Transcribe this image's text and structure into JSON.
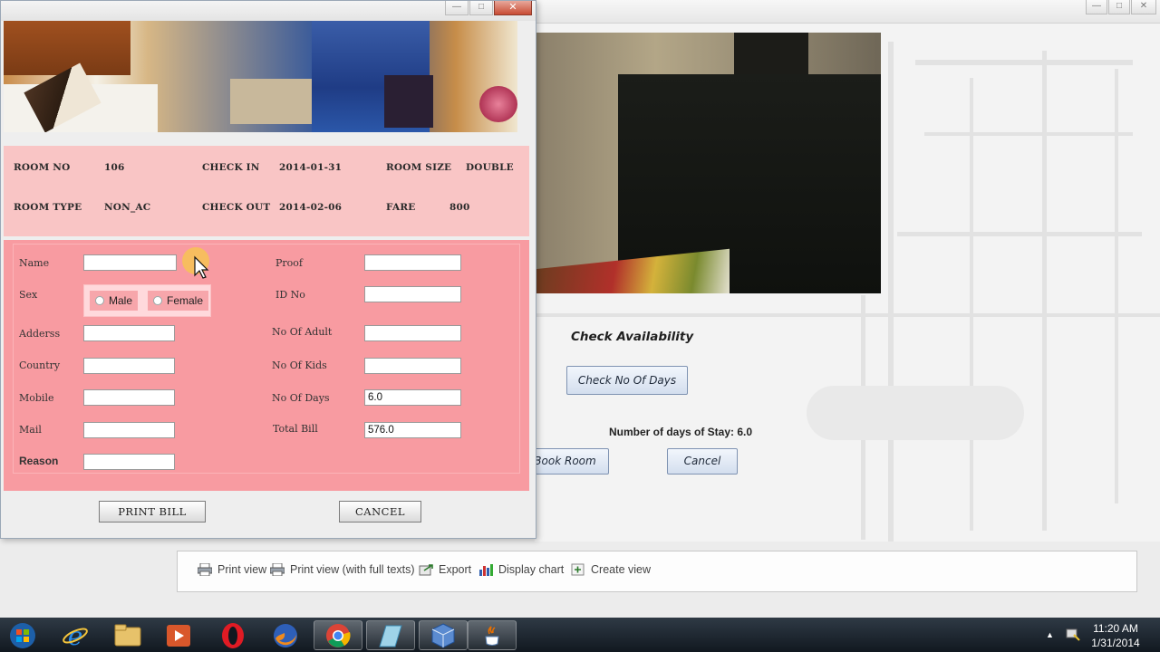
{
  "background_window": {
    "check_availability_label": "Check Availability",
    "check_days_button": "Check No Of Days",
    "days_of_stay_text": "Number of days of Stay: 6.0",
    "book_room_button": "Book Room",
    "cancel_button": "Cancel",
    "controls": [
      "—",
      "□",
      "✕"
    ]
  },
  "view_toolbar": {
    "print_view": "Print view",
    "print_view_full": "Print view (with full texts)",
    "export": "Export",
    "display_chart": "Display chart",
    "create_view": "Create view"
  },
  "dialog": {
    "controls": [
      "—",
      "□",
      "✕"
    ],
    "room_info": {
      "room_no_label": "ROOM NO",
      "room_no_value": "106",
      "check_in_label": "CHECK IN",
      "check_in_value": "2014-01-31",
      "room_size_label": "ROOM SIZE",
      "room_size_value": "DOUBLE",
      "room_type_label": "ROOM TYPE",
      "room_type_value": "NON_AC",
      "check_out_label": "CHECK OUT",
      "check_out_value": "2014-02-06",
      "fare_label": "FARE",
      "fare_value": "800"
    },
    "form": {
      "name_label": "Name",
      "name_value": "",
      "sex_label": "Sex",
      "sex_options": [
        "Male",
        "Female"
      ],
      "address_label": "Adderss",
      "address_value": "",
      "country_label": "Country",
      "country_value": "",
      "mobile_label": "Mobile",
      "mobile_value": "",
      "mail_label": "Mail",
      "mail_value": "",
      "reason_label": "Reason",
      "reason_value": "",
      "proof_label": "Proof",
      "proof_value": "",
      "id_no_label": "ID No",
      "id_no_value": "",
      "adults_label": "No Of Adult",
      "adults_value": "",
      "kids_label": "No Of Kids",
      "kids_value": "",
      "days_label": "No Of Days",
      "days_value": "6.0",
      "total_label": "Total Bill",
      "total_value": "576.0"
    },
    "print_bill_button": "PRINT BILL",
    "cancel_button": "CANCEL"
  },
  "taskbar": {
    "icons": [
      "windows-start-icon",
      "internet-explorer-icon",
      "file-explorer-icon",
      "media-player-icon",
      "opera-icon",
      "firefox-icon",
      "chrome-icon",
      "app-icon",
      "virtualbox-icon",
      "java-icon"
    ],
    "time": "11:20 AM",
    "date": "1/31/2014"
  },
  "colors": {
    "info_panel": "#f9c5c5",
    "form_panel": "#f89ba1",
    "button_accent": "#d3deee"
  }
}
